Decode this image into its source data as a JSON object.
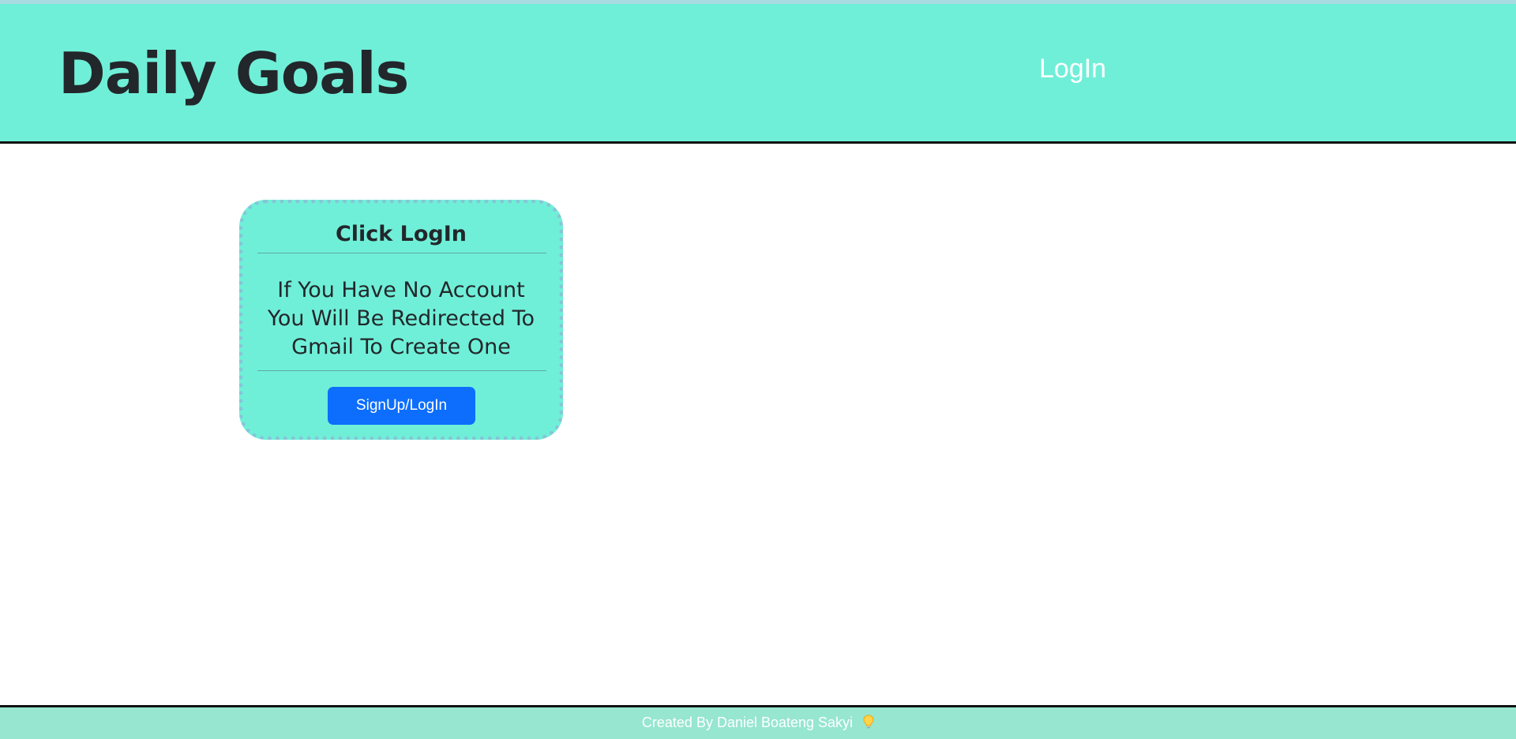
{
  "header": {
    "brand": "Daily Goals",
    "nav_login": "LogIn"
  },
  "card": {
    "title": "Click LogIn",
    "message_lines": [
      "If You Have No Account",
      "You Will Be Redirected To",
      "Gmail To Create One"
    ],
    "button_label": "SignUp/LogIn"
  },
  "footer": {
    "credit": "Created By Daniel Boateng Sakyi",
    "icon": "lightbulb-icon"
  },
  "colors": {
    "header_background": "#70efd8",
    "card_background": "#70efd8",
    "card_border": "#85c6d6",
    "button_background": "#0d6efd",
    "footer_background": "#96e6d0",
    "text_dark": "#22272b",
    "text_light": "#ffffff"
  }
}
